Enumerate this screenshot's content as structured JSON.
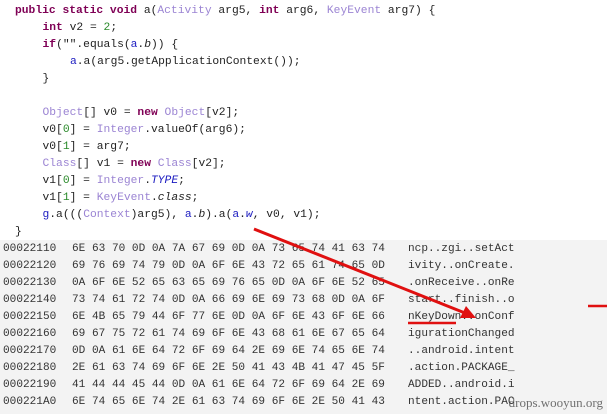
{
  "code_lines": [
    {
      "indent": 0,
      "tokens": [
        [
          "kw",
          "public static void "
        ],
        [
          "",
          "a("
        ],
        [
          "ty",
          "Activity"
        ],
        [
          "",
          " arg5, "
        ],
        [
          "kw",
          "int"
        ],
        [
          "",
          " arg6, "
        ],
        [
          "ty",
          "KeyEvent"
        ],
        [
          "",
          " arg7) {"
        ]
      ]
    },
    {
      "indent": 1,
      "tokens": [
        [
          "kw",
          "int"
        ],
        [
          "",
          " v2 = "
        ],
        [
          "nu",
          "2"
        ],
        [
          "",
          ";"
        ]
      ]
    },
    {
      "indent": 1,
      "tokens": [
        [
          "kw",
          "if"
        ],
        [
          "",
          "(\"\".equals("
        ],
        [
          "fi",
          "a"
        ],
        [
          "",
          "."
        ],
        [
          "it",
          "b"
        ],
        [
          "",
          "))"
        ],
        [
          "",
          " {"
        ]
      ]
    },
    {
      "indent": 2,
      "tokens": [
        [
          "fi",
          "a"
        ],
        [
          "",
          ".a(arg5.getApplicationContext());"
        ]
      ]
    },
    {
      "indent": 1,
      "tokens": [
        [
          "",
          "}"
        ]
      ]
    },
    {
      "indent": 1,
      "tokens": []
    },
    {
      "indent": 1,
      "tokens": [
        [
          "ty",
          "Object"
        ],
        [
          "",
          "[] v0 = "
        ],
        [
          "kw",
          "new"
        ],
        [
          "",
          " "
        ],
        [
          "ty",
          "Object"
        ],
        [
          "",
          "[v2];"
        ]
      ]
    },
    {
      "indent": 1,
      "tokens": [
        [
          "",
          "v0["
        ],
        [
          "nu",
          "0"
        ],
        [
          "",
          "] = "
        ],
        [
          "ty",
          "Integer"
        ],
        [
          "",
          ".valueOf(arg6);"
        ]
      ]
    },
    {
      "indent": 1,
      "tokens": [
        [
          "",
          "v0["
        ],
        [
          "nu",
          "1"
        ],
        [
          "",
          "] = arg7;"
        ]
      ]
    },
    {
      "indent": 1,
      "tokens": [
        [
          "ty",
          "Class"
        ],
        [
          "",
          "[] v1 = "
        ],
        [
          "kw",
          "new"
        ],
        [
          "",
          " "
        ],
        [
          "ty",
          "Class"
        ],
        [
          "",
          "[v2];"
        ]
      ]
    },
    {
      "indent": 1,
      "tokens": [
        [
          "",
          "v1["
        ],
        [
          "nu",
          "0"
        ],
        [
          "",
          "] = "
        ],
        [
          "ty",
          "Integer"
        ],
        [
          "",
          "."
        ],
        [
          "fit",
          "TYPE"
        ],
        [
          "",
          ";"
        ]
      ]
    },
    {
      "indent": 1,
      "tokens": [
        [
          "",
          "v1["
        ],
        [
          "nu",
          "1"
        ],
        [
          "",
          "] = "
        ],
        [
          "ty",
          "KeyEvent"
        ],
        [
          "",
          "."
        ],
        [
          "it",
          "class"
        ],
        [
          "",
          ";"
        ]
      ]
    },
    {
      "indent": 1,
      "tokens": [
        [
          "fi",
          "g"
        ],
        [
          "",
          ".a((("
        ],
        [
          "ty",
          "Context"
        ],
        [
          "",
          ")arg5), "
        ],
        [
          "fi",
          "a"
        ],
        [
          "",
          "."
        ],
        [
          "it",
          "b"
        ],
        [
          "",
          ").a("
        ],
        [
          "fi",
          "a"
        ],
        [
          "",
          "."
        ],
        [
          "fit",
          "w"
        ],
        [
          "",
          ", v0, v1);"
        ]
      ]
    },
    {
      "indent": 0,
      "tokens": [
        [
          "",
          "}"
        ]
      ]
    }
  ],
  "hex_rows": [
    {
      "offset": "00022110",
      "bytes": "6E 63 70 0D 0A 7A 67 69 0D 0A 73 65 74 41 63 74",
      "ascii": "ncp..zgi..setAct"
    },
    {
      "offset": "00022120",
      "bytes": "69 76 69 74 79 0D 0A 6F 6E 43 72 65 61 74 65 0D",
      "ascii": "ivity..onCreate."
    },
    {
      "offset": "00022130",
      "bytes": "0A 6F 6E 52 65 63 65 69 76 65 0D 0A 6F 6E 52 65",
      "ascii": ".onReceive..onRe"
    },
    {
      "offset": "00022140",
      "bytes": "73 74 61 72 74 0D 0A 66 69 6E 69 73 68 0D 0A 6F",
      "ascii": "start..finish..o"
    },
    {
      "offset": "00022150",
      "bytes": "6E 4B 65 79 44 6F 77 6E 0D 0A 6F 6E 43 6F 6E 66",
      "ascii": "nKeyDown..onConf"
    },
    {
      "offset": "00022160",
      "bytes": "69 67 75 72 61 74 69 6F 6E 43 68 61 6E 67 65 64",
      "ascii": "igurationChanged"
    },
    {
      "offset": "00022170",
      "bytes": "0D 0A 61 6E 64 72 6F 69 64 2E 69 6E 74 65 6E 74",
      "ascii": "..android.intent"
    },
    {
      "offset": "00022180",
      "bytes": "2E 61 63 74 69 6F 6E 2E 50 41 43 4B 41 47 45 5F",
      "ascii": ".action.PACKAGE_"
    },
    {
      "offset": "00022190",
      "bytes": "41 44 44 45 44 0D 0A 61 6E 64 72 6F 69 64 2E 69",
      "ascii": "ADDED..android.i"
    },
    {
      "offset": "000221A0",
      "bytes": "6E 74 65 6E 74 2E 61 63 74 69 6F 6E 2E 50 41 43",
      "ascii": "ntent.action.PAC"
    }
  ],
  "watermark": "drops.wooyun.org",
  "colors": {
    "annotation": "#e01010"
  }
}
